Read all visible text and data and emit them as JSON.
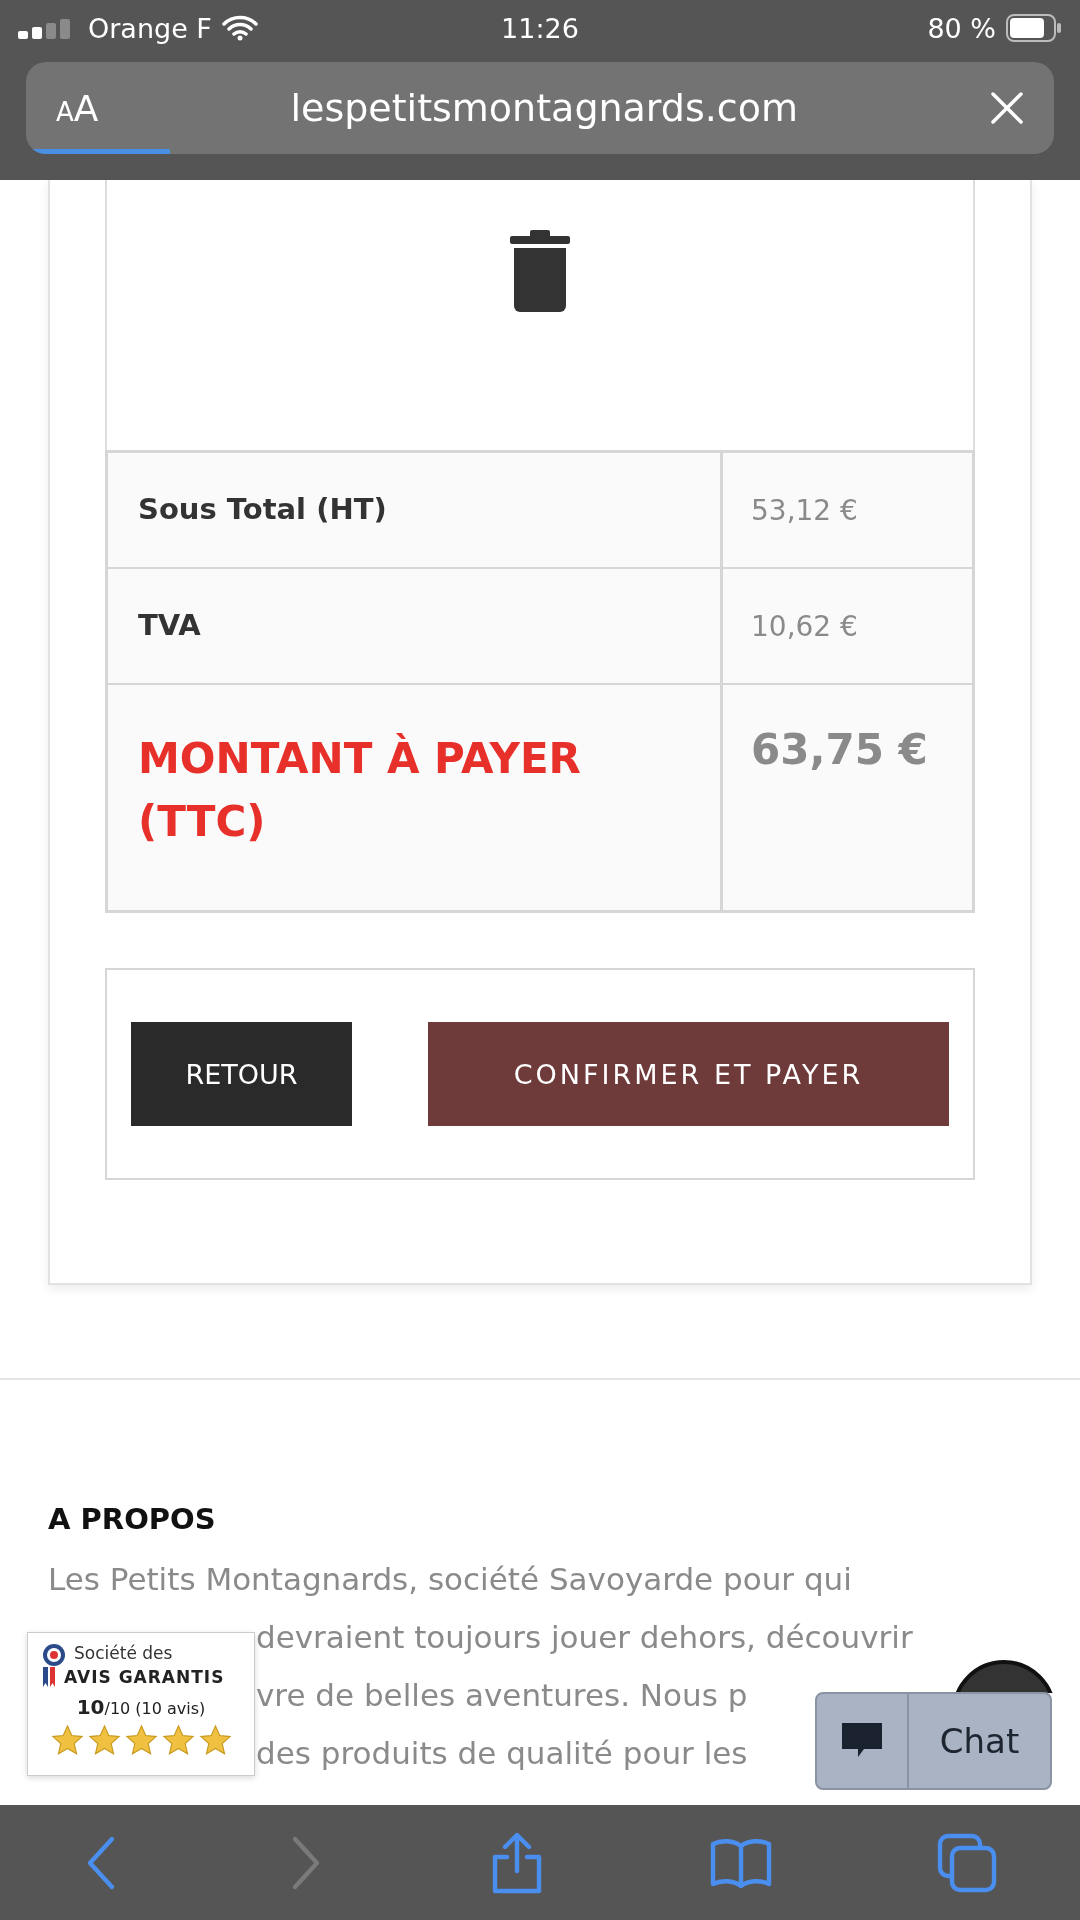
{
  "status_bar": {
    "carrier": "Orange F",
    "time": "11:26",
    "battery": "80 %"
  },
  "address_bar": {
    "text_size": {
      "small": "A",
      "large": "A"
    },
    "url": "lespetitsmontagnards.com",
    "loading": {
      "level": 0.14
    }
  },
  "cart": {
    "totals": [
      {
        "label": "Sous Total (HT)",
        "value": "53,12 €",
        "kind": "normal"
      },
      {
        "label": "TVA",
        "value": "10,62 €",
        "kind": "normal"
      },
      {
        "label": "MONTANT À PAYER (TTC)",
        "value": "63,75 €",
        "kind": "total"
      }
    ],
    "buttons": [
      {
        "label": "RETOUR",
        "kind": "secondary"
      },
      {
        "label": "CONFIRMER ET PAYER",
        "kind": "primary"
      }
    ]
  },
  "about": {
    "title": "A PROPOS",
    "lines": [
      {
        "text": "Les Petits Montagnards, société Savoyarde pour qui",
        "covered": false
      },
      {
        "text": "devraient toujours jouer dehors, découvrir",
        "covered": true
      },
      {
        "text": "vre de belles aventures. Nous p",
        "covered": true
      },
      {
        "text": "des produits de qualité pour les",
        "covered": true
      }
    ]
  },
  "reviews_badge": {
    "brand_top": "Société des",
    "brand_bottom": "AVIS GARANTIS",
    "score": "10",
    "score_suffix": "/10 (10 avis)",
    "stars": 5
  },
  "chat": {
    "label": "Chat"
  },
  "toolbar": [
    {
      "kind": "back",
      "disabled": false
    },
    {
      "kind": "forward",
      "disabled": true
    },
    {
      "kind": "share",
      "disabled": false
    },
    {
      "kind": "bookmarks",
      "disabled": false
    },
    {
      "kind": "tabs",
      "disabled": false
    }
  ]
}
